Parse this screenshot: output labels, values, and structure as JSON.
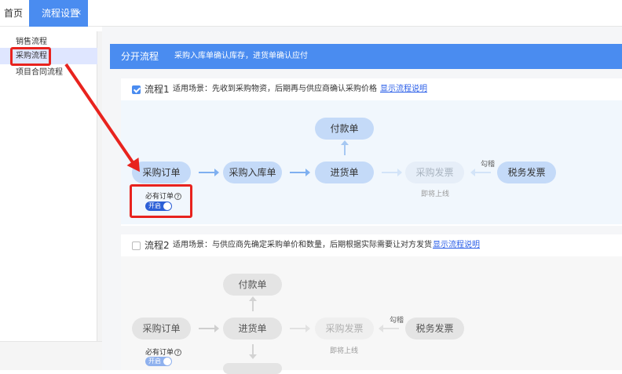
{
  "tabs": {
    "home": "首页",
    "active": "流程设置",
    "close": "×"
  },
  "sidebar": {
    "items": [
      {
        "label": "销售流程"
      },
      {
        "label": "采购流程"
      },
      {
        "label": "项目合同流程"
      }
    ]
  },
  "banner": {
    "title": "分开流程",
    "subtitle": "采购入库单确认库存，进货单确认应付"
  },
  "flow1": {
    "checked": true,
    "title": "流程1",
    "desc": "适用场景：先收到采购物资，后期再与供应商确认采购价格",
    "link": "显示流程说明",
    "nodes": {
      "order": "采购订单",
      "inbound": "采购入库单",
      "receipt": "进货单",
      "payment": "付款单",
      "invoice": "采购发票",
      "tax_invoice": "税务发票"
    },
    "hook_label": "勾稽",
    "coming_soon": "即将上线",
    "required_label": "必有订单",
    "toggle_label": "开启"
  },
  "flow2": {
    "checked": false,
    "title": "流程2",
    "desc": "适用场景：与供应商先确定采购单价和数量，后期根据实际需要让对方发货",
    "link": "显示流程说明",
    "nodes": {
      "order": "采购订单",
      "receipt": "进货单",
      "payment": "付款单",
      "invoice": "采购发票",
      "tax_invoice": "税务发票"
    },
    "hook_label": "勾稽",
    "coming_soon": "即将上线",
    "required_label": "必有订单",
    "toggle_label": "开启"
  },
  "colors": {
    "accent": "#4a8cf0",
    "annotation": "#e8231e",
    "link": "#2a5ee8"
  }
}
